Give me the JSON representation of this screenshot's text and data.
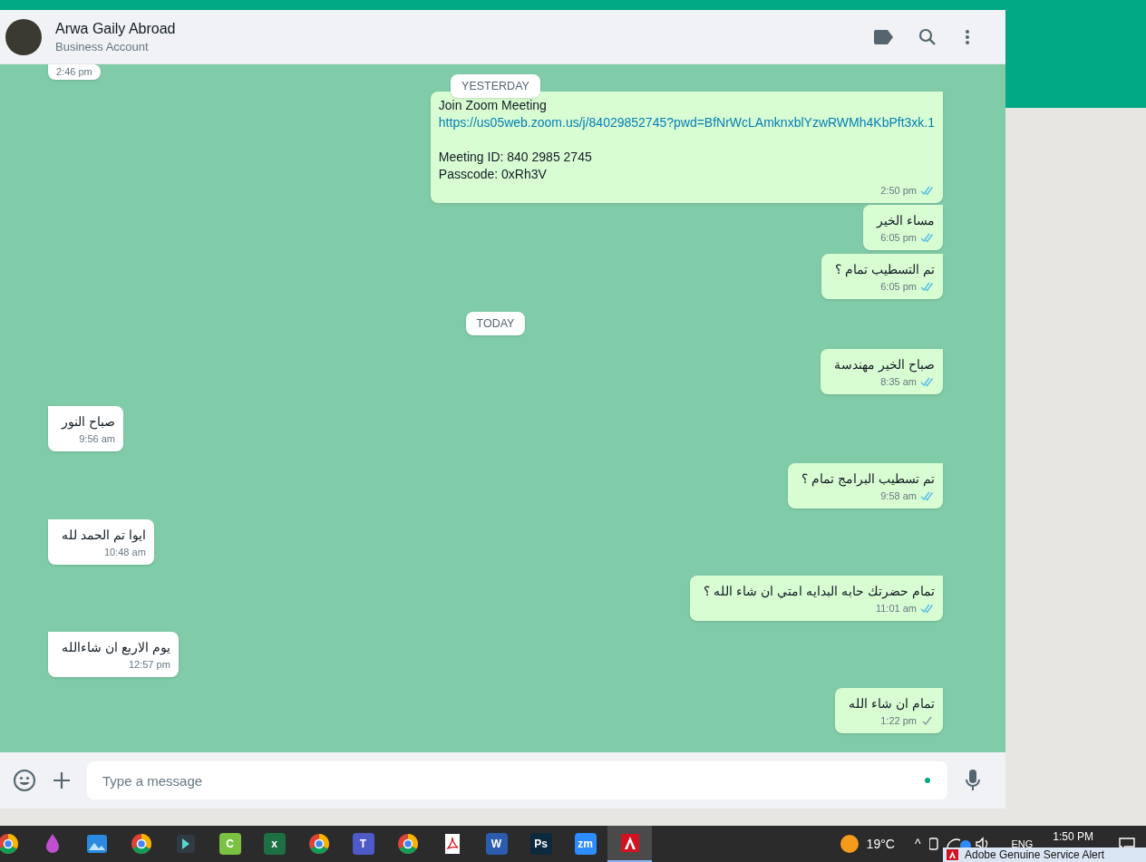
{
  "chat_header": {
    "contact_name": "Arwa Gaily Abroad",
    "subtitle": "Business Account"
  },
  "messages": [
    {
      "kind": "incoming",
      "time": "2:46 pm"
    },
    {
      "kind": "date",
      "text": "YESTERDAY"
    },
    {
      "kind": "outgoing",
      "paragraphs": [
        [
          {
            "kind": "text",
            "text": "Join Zoom Meeting"
          },
          {
            "kind": "link",
            "text": "https://us05web.zoom.us/j/84029852745?pwd=BfNrWcLAmknxblYzwRWMh4KbPft3xk.1"
          }
        ],
        [
          {
            "kind": "text",
            "text": "Meeting ID: 840 2985 2745"
          },
          {
            "kind": "text",
            "text": "Passcode: 0xRh3V"
          }
        ]
      ],
      "time": "2:50 pm",
      "read": true
    },
    {
      "kind": "outgoing",
      "text": "مساء الخير",
      "time": "6:05 pm",
      "read": true
    },
    {
      "kind": "outgoing",
      "text": "تم التسطيب تمام ؟",
      "time": "6:05 pm",
      "read": true
    },
    {
      "kind": "date",
      "text": "TODAY"
    },
    {
      "kind": "outgoing",
      "text": "صباح الخير مهندسة",
      "time": "8:35 am",
      "read": true
    },
    {
      "kind": "incoming",
      "text": "صباح النور",
      "time": "9:56 am"
    },
    {
      "kind": "outgoing",
      "text": "تم تسطيب البرامج تمام ؟",
      "time": "9:58 am",
      "read": true
    },
    {
      "kind": "incoming",
      "text": "ايوا تم الحمد لله",
      "time": "10:48 am"
    },
    {
      "kind": "outgoing",
      "text": "تمام حضرتك حابه البدايه امتي ان شاء الله ؟",
      "time": "11:01 am",
      "read": true
    },
    {
      "kind": "incoming",
      "text": "يوم الاربع ان شاءالله",
      "time": "12:57 pm"
    },
    {
      "kind": "outgoing",
      "text": "تمام ان شاء الله",
      "time": "1:22 pm",
      "read": false
    }
  ],
  "composer": {
    "placeholder": "Type a message"
  },
  "taskbar": {
    "apps": [
      {
        "kind": "browser"
      },
      {
        "kind": "drop"
      },
      {
        "kind": "photos"
      },
      {
        "kind": "browser"
      },
      {
        "kind": "editor"
      },
      {
        "kind": "letter",
        "label": "C",
        "color": "#7cc242"
      },
      {
        "kind": "letter",
        "label": "x",
        "color": "#1d7044"
      },
      {
        "kind": "browser"
      },
      {
        "kind": "letter",
        "label": "T",
        "color": "#5059c9"
      },
      {
        "kind": "browser"
      },
      {
        "kind": "pdf"
      },
      {
        "kind": "letter",
        "label": "W",
        "color": "#2b5cb0"
      },
      {
        "kind": "letter",
        "label": "Ps",
        "color": "#0b2a3f"
      },
      {
        "kind": "letter",
        "label": "zm",
        "color": "#2d8cff"
      },
      {
        "kind": "adobe",
        "selected": true
      }
    ],
    "temperature": "19°C",
    "tray_caret": "^",
    "language": "ENG",
    "time": "1:50 PM"
  },
  "notification": {
    "title": "Adobe Genuine Service Alert"
  }
}
